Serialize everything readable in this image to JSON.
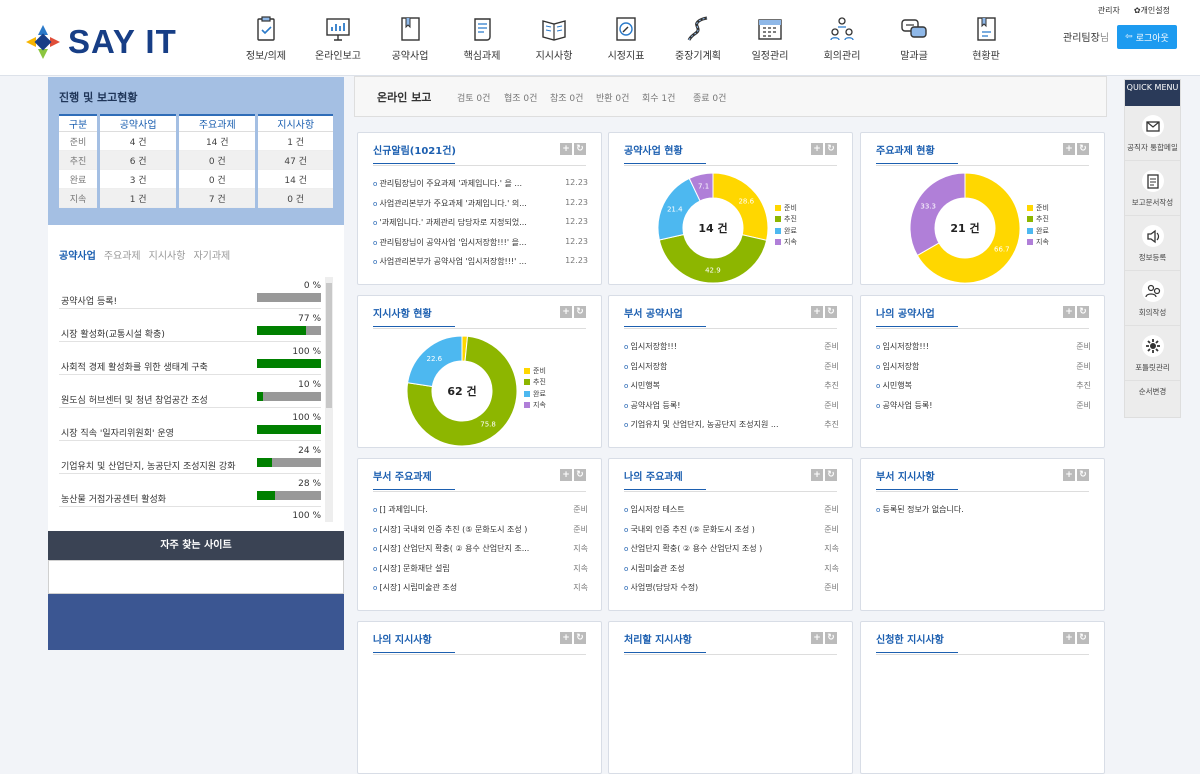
{
  "brand": {
    "name": "SAY IT"
  },
  "nav": [
    {
      "label": "정보/의제",
      "icon": "clipboard-icon"
    },
    {
      "label": "온라인보고",
      "icon": "monitor-chart-icon"
    },
    {
      "label": "공약사업",
      "icon": "book-icon"
    },
    {
      "label": "핵심과제",
      "icon": "scroll-icon"
    },
    {
      "label": "지시사항",
      "icon": "open-book-icon"
    },
    {
      "label": "시정지표",
      "icon": "compass-icon"
    },
    {
      "label": "중장기계획",
      "icon": "road-icon"
    },
    {
      "label": "일정관리",
      "icon": "calendar-icon"
    },
    {
      "label": "회의관리",
      "icon": "meeting-icon"
    },
    {
      "label": "말과글",
      "icon": "chat-icon"
    },
    {
      "label": "현황판",
      "icon": "board-icon"
    }
  ],
  "top": {
    "admin": "관리자",
    "personal": "✿개인설정",
    "user": "관리팀장",
    "user_suffix": "님",
    "logout": "로그아웃"
  },
  "progress": {
    "title": "진행 및 보고현황",
    "headers": [
      "구분",
      "공약사업",
      "주요과제",
      "지시사항"
    ],
    "rows": [
      [
        "준비",
        "4 건",
        "14 건",
        "1 건"
      ],
      [
        "추진",
        "6 건",
        "0 건",
        "47 건"
      ],
      [
        "완료",
        "3 건",
        "0 건",
        "14 건"
      ],
      [
        "지속",
        "1 건",
        "7 건",
        "0 건"
      ]
    ]
  },
  "left_tabs": [
    "공약사업",
    "주요과제",
    "지시사항",
    "자기과제"
  ],
  "left_list": [
    {
      "name": "공약사업 등록!",
      "pct": "0 %",
      "val": 0
    },
    {
      "name": "시장 활성화(교통시설 확충)",
      "pct": "77 %",
      "val": 77
    },
    {
      "name": "사회적 경제 활성화를 위한 생태계 구축",
      "pct": "100 %",
      "val": 100
    },
    {
      "name": "원도심 허브센터 및 청년 창업공간 조성",
      "pct": "10 %",
      "val": 10
    },
    {
      "name": "시장 직속 '일자리위원회' 운영",
      "pct": "100 %",
      "val": 100
    },
    {
      "name": "기업유치 및 산업단지, 농공단지 조성지원 강화",
      "pct": "24 %",
      "val": 24
    },
    {
      "name": "농산물 거점가공센터 활성화",
      "pct": "28 %",
      "val": 28
    },
    {
      "name": "",
      "pct": "100 %",
      "val": 100
    }
  ],
  "favorites": {
    "title": "자주 찾는 사이트"
  },
  "tabbar": {
    "main": "온라인 보고",
    "subs": [
      "검토 0건",
      "협조 0건",
      "참조 0건",
      "반환 0건",
      "회수 1건",
      "종료 0건"
    ]
  },
  "legend_labels": [
    "준비",
    "추진",
    "완료",
    "지속"
  ],
  "legend_colors": [
    "#ffd700",
    "#8db600",
    "#4db8f0",
    "#b07fd8"
  ],
  "panels": {
    "notices": {
      "title": "신규알림(1021건)",
      "items": [
        {
          "text": "관리팀장님이 주요과제 '과제입니다.' 을 ...",
          "date": "12.23"
        },
        {
          "text": "사업관리본부가 주요과제 '과제입니다.' 의...",
          "date": "12.23"
        },
        {
          "text": "'과제입니다.' 과제관리 담당자로 지정되었...",
          "date": "12.23"
        },
        {
          "text": "관리팀장님이 공약사업 '임시저장함!!!' 을...",
          "date": "12.23"
        },
        {
          "text": "사업관리본부가 공약사업 '임시저장함!!!' ...",
          "date": "12.23"
        }
      ]
    },
    "pledge_status": {
      "title": "공약사업 현황",
      "center": "14 건"
    },
    "major_status": {
      "title": "주요과제 현황",
      "center": "21 건"
    },
    "directive_status": {
      "title": "지시사항 현황",
      "center": "62 건"
    },
    "dept_pledge": {
      "title": "부서 공약사업",
      "items": [
        {
          "text": "임시저장함!!!",
          "status": "준비"
        },
        {
          "text": "임시저장함",
          "status": "준비"
        },
        {
          "text": "시민행복",
          "status": "추진"
        },
        {
          "text": "공약사업 등록!",
          "status": "준비"
        },
        {
          "text": "기업유치 및 산업단지, 농공단지 조성지원 ...",
          "status": "추진"
        }
      ]
    },
    "my_pledge": {
      "title": "나의 공약사업",
      "items": [
        {
          "text": "임시저장함!!!",
          "status": "준비"
        },
        {
          "text": "임시저장함",
          "status": "준비"
        },
        {
          "text": "시민행복",
          "status": "추진"
        },
        {
          "text": "공약사업 등록!",
          "status": "준비"
        }
      ]
    },
    "dept_major": {
      "title": "부서 주요과제",
      "items": [
        {
          "text": "[] 과제입니다.",
          "status": "준비"
        },
        {
          "text": "[시장] 국내외 인증 추진 (⑤ 문화도시 조성 )",
          "status": "준비"
        },
        {
          "text": "[시장] 산업단지 확충( ② 용수 산업단지 조...",
          "status": "지속"
        },
        {
          "text": "[시장] 문화재단 설립",
          "status": "지속"
        },
        {
          "text": "[시장] 시립미술관 조성",
          "status": "지속"
        }
      ]
    },
    "my_major": {
      "title": "나의 주요과제",
      "items": [
        {
          "text": "임시저장 테스트",
          "status": "준비"
        },
        {
          "text": "국내외 인증 추진 (⑤ 문화도시 조성 )",
          "status": "준비"
        },
        {
          "text": "산업단지 확충( ② 용수 산업단지 조성 )",
          "status": "지속"
        },
        {
          "text": "시립미술관 조성",
          "status": "지속"
        },
        {
          "text": "사업명(담당자 수정)",
          "status": "준비"
        }
      ]
    },
    "dept_directive": {
      "title": "부서 지시사항",
      "items": [
        {
          "text": "등록된 정보가 없습니다.",
          "status": ""
        }
      ]
    },
    "my_directive": {
      "title": "나의 지시사항"
    },
    "todo_directive": {
      "title": "처리할 지시사항"
    },
    "req_directive": {
      "title": "신청한 지시사항"
    }
  },
  "quick": {
    "title": "QUICK MENU",
    "items": [
      {
        "label": "공직자 통합메일",
        "icon": "mail-icon"
      },
      {
        "label": "보고문서작성",
        "icon": "document-icon"
      },
      {
        "label": "정보등록",
        "icon": "speaker-icon"
      },
      {
        "label": "회의작성",
        "icon": "people-icon"
      },
      {
        "label": "포틀릿관리",
        "icon": "gear-icon"
      }
    ],
    "last": "순서변경"
  },
  "chart_data": [
    {
      "type": "pie",
      "title": "공약사업 현황",
      "categories": [
        "준비",
        "추진",
        "완료",
        "지속"
      ],
      "values": [
        28.6,
        42.9,
        21.4,
        7.1
      ]
    },
    {
      "type": "pie",
      "title": "주요과제 현황",
      "categories": [
        "준비",
        "추진",
        "완료",
        "지속"
      ],
      "values": [
        66.7,
        0,
        0,
        33.3
      ]
    },
    {
      "type": "pie",
      "title": "지시사항 현황",
      "categories": [
        "준비",
        "추진",
        "완료",
        "지속"
      ],
      "values": [
        1.6,
        75.8,
        22.6,
        0
      ]
    }
  ]
}
